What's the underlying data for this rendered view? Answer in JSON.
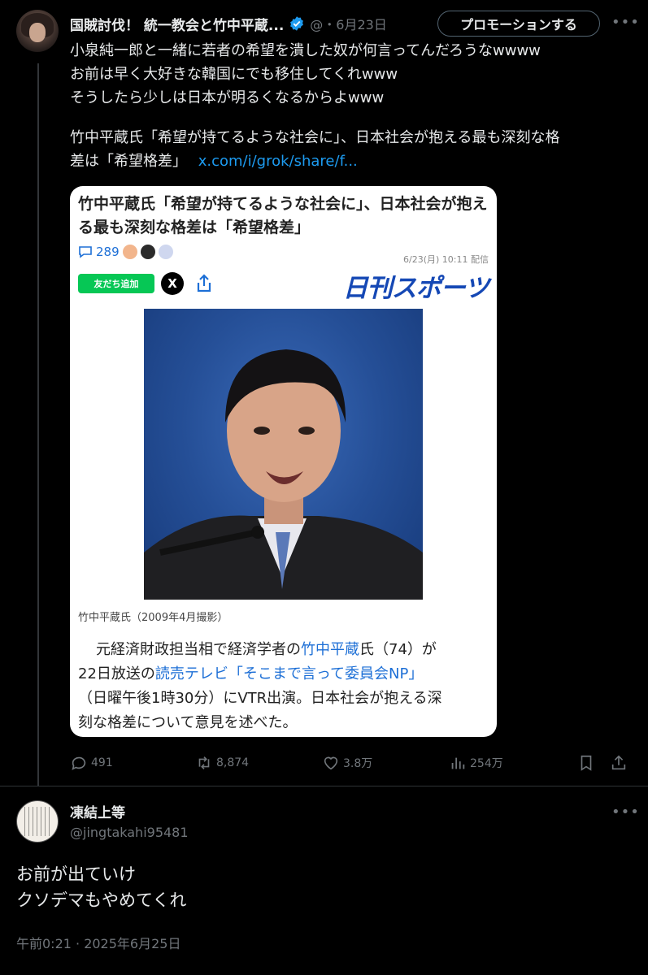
{
  "tweet": {
    "author_name": "国賊討伐！ 統一教会と竹中平蔵...",
    "handle_date": "@・6月23日",
    "promote_label": "プロモーションする",
    "text_lines": [
      "小泉純一郎と一緒に若者の希望を潰した奴が何言ってんだろうなwwww",
      "お前は早く大好きな韓国にでも移住してくれwww",
      "そうしたら少しは日本が明るくなるからよwww",
      "竹中平蔵氏「希望が持てるような社会に」、日本社会が抱える最も深刻な格",
      "差は「希望格差」"
    ],
    "link_text": "x.com/i/grok/share/f...",
    "stats": {
      "replies": "491",
      "retweets": "8,874",
      "likes": "3.8万",
      "views": "254万"
    }
  },
  "card": {
    "title": "竹中平蔵氏「希望が持てるような社会に」、日本社会が抱える最も深刻な格差は「希望格差」",
    "comment_count": "289",
    "dateline": "6/23(月) 10:11 配信",
    "line_button": "友だち追加",
    "x_label": "X",
    "brand": "日刊スポーツ",
    "caption": "竹中平蔵氏（2009年4月撮影）",
    "article": {
      "p1": "元経済財政担当相で経済学者の",
      "kw1": "竹中平蔵",
      "p2": "氏（74）が",
      "p3": "22日放送の",
      "kw2": "読売テレビ",
      "kw3": "「そこまで言って委員会NP」",
      "p4": "（日曜午後1時30分）にVTR出演。日本社会が抱える深",
      "p5": "刻な格差について意見を述べた。"
    }
  },
  "reply": {
    "author_name": "凍結上等",
    "handle": "@jingtakahi95481",
    "lines": [
      "お前が出ていけ",
      "クソデマもやめてくれ"
    ],
    "timestamp": "午前0:21 · 2025年6月25日"
  },
  "colors": {
    "background": "#000000",
    "accent_link": "#1d9bf0",
    "muted": "#71767b",
    "line_green": "#06c755",
    "brand_blue": "#1548b5"
  },
  "icons": [
    "verified-badge-icon",
    "more-icon",
    "comment-icon",
    "retweet-icon",
    "heart-icon",
    "views-icon",
    "bookmark-icon",
    "share-icon"
  ]
}
